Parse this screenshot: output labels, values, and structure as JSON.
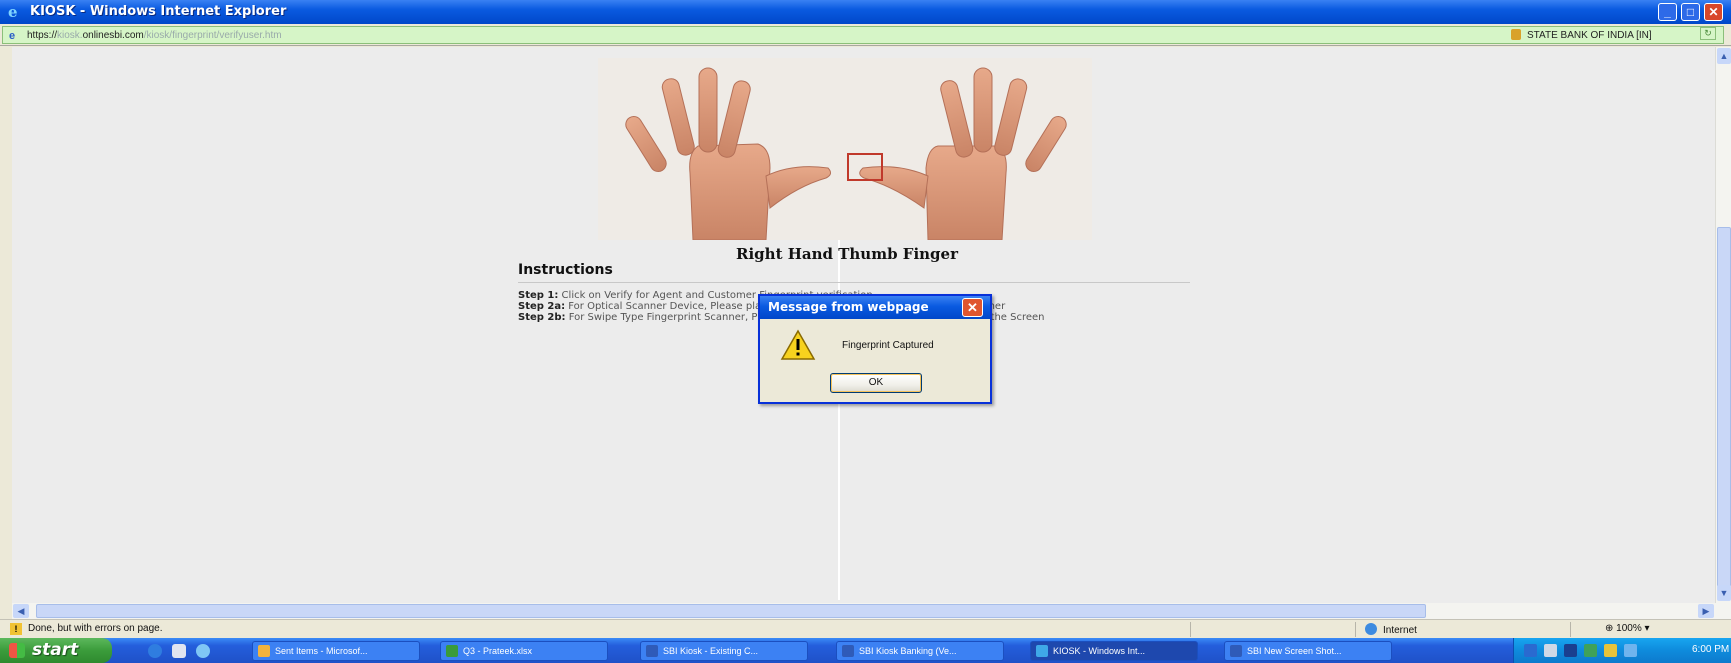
{
  "window": {
    "title": "KIOSK - Windows Internet Explorer",
    "min_glyph": "_",
    "max_glyph": "□",
    "close_glyph": "✕"
  },
  "addressbar": {
    "url_prefix": "https://",
    "url_domain": "onlinesbi.com",
    "url_path": "/kiosk/fingerprint/verifyuser.htm",
    "certificate": "STATE BANK OF INDIA [IN]",
    "refresh_glyph": "↻"
  },
  "page": {
    "finger_title": "Right Hand Thumb Finger",
    "instructions_heading": "Instructions",
    "steps": [
      {
        "label": "Step 1:",
        "text": " Click on Verify for Agent and Customer Fingerprint verification"
      },
      {
        "label": "Step 2a:",
        "text": " For Optical Scanner Device, Please place finger when Light is displayed on the Scanner"
      },
      {
        "label": "Step 2b:",
        "text": " For Swipe Type Fingerprint Scanner, Please swipe finger once Popup is displayed on the Screen"
      }
    ]
  },
  "dialog": {
    "title": "Message from webpage",
    "message": "Fingerprint Captured",
    "ok_label": "OK",
    "close_glyph": "✕",
    "icon": "warning-icon"
  },
  "statusbar": {
    "status_text": "Done, but with errors on page.",
    "zone": "Internet",
    "zoom": "100%",
    "zoom_prefix": "⊕",
    "zoom_arrow": "▾"
  },
  "taskbar": {
    "start_label": "start",
    "tasks": [
      {
        "label": "Sent Items - Microsof...",
        "color": "#F2B33D"
      },
      {
        "label": "Q3 - Prateek.xlsx",
        "color": "#3A9B3A"
      },
      {
        "label": "SBI Kiosk - Existing C...",
        "color": "#2F5BB8"
      },
      {
        "label": "SBI Kiosk Banking (Ve...",
        "color": "#2F5BB8"
      },
      {
        "label": "KIOSK - Windows Int...",
        "color": "#3FA8E8"
      },
      {
        "label": "SBI New Screen Shot...",
        "color": "#2F5BB8"
      }
    ],
    "clock": "6:00 PM"
  },
  "scroll": {
    "up": "▲",
    "down": "▼",
    "left": "◀",
    "right": "▶"
  }
}
